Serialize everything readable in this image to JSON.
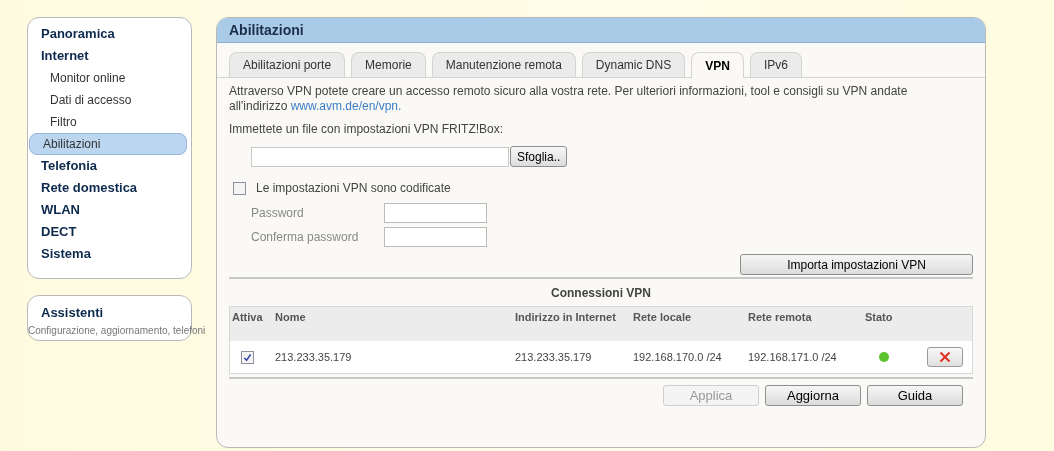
{
  "sidebar": {
    "items": [
      {
        "label": "Panoramica",
        "selected": false
      },
      {
        "label": "Internet",
        "selected": false,
        "children": [
          {
            "label": "Monitor online",
            "selected": false
          },
          {
            "label": "Dati di accesso",
            "selected": false
          },
          {
            "label": "Filtro",
            "selected": false
          },
          {
            "label": "Abilitazioni",
            "selected": true
          }
        ]
      },
      {
        "label": "Telefonia",
        "selected": false
      },
      {
        "label": "Rete domestica",
        "selected": false
      },
      {
        "label": "WLAN",
        "selected": false
      },
      {
        "label": "DECT",
        "selected": false
      },
      {
        "label": "Sistema",
        "selected": false
      }
    ]
  },
  "assistant": {
    "title": "Assistenti",
    "description": "Configurazione, aggiornamento, telefoni"
  },
  "panel": {
    "title": "Abilitazioni"
  },
  "tabs": [
    {
      "label": "Abilitazioni porte",
      "selected": false
    },
    {
      "label": "Memorie",
      "selected": false
    },
    {
      "label": "Manutenzione remota",
      "selected": false
    },
    {
      "label": "Dynamic DNS",
      "selected": false
    },
    {
      "label": "VPN",
      "selected": true
    },
    {
      "label": "IPv6",
      "selected": false
    }
  ],
  "intro": {
    "text": "Attraverso VPN potete creare un accesso remoto sicuro alla vostra rete. Per ulteriori informazioni, tool e consigli su VPN andate all'indirizzo ",
    "link": "www.avm.de/en/vpn."
  },
  "file_prompt": "Immettete un file con impostazioni VPN FRITZ!Box:",
  "browse_button": "Sfoglia..",
  "encrypted": {
    "label": "Le impostazioni VPN sono codificate",
    "checked": false
  },
  "password_fields": [
    {
      "label": "Password"
    },
    {
      "label": "Conferma password"
    }
  ],
  "import_button": "Importa impostazioni VPN",
  "connections": {
    "title": "Connessioni VPN",
    "columns": [
      "Attiva",
      "Nome",
      "Indirizzo in Internet",
      "Rete locale",
      "Rete remota",
      "Stato"
    ],
    "rows": [
      {
        "active": true,
        "name": "213.233.35.179",
        "address": "213.233.35.179",
        "local": "192.168.170.0 /24",
        "remote": "192.168.171.0 /24",
        "color": "#5cc22e"
      }
    ]
  },
  "buttons": [
    {
      "label": "Applica",
      "disabled": true
    },
    {
      "label": "Aggiorna",
      "disabled": false
    },
    {
      "label": "Guida",
      "disabled": false
    }
  ]
}
